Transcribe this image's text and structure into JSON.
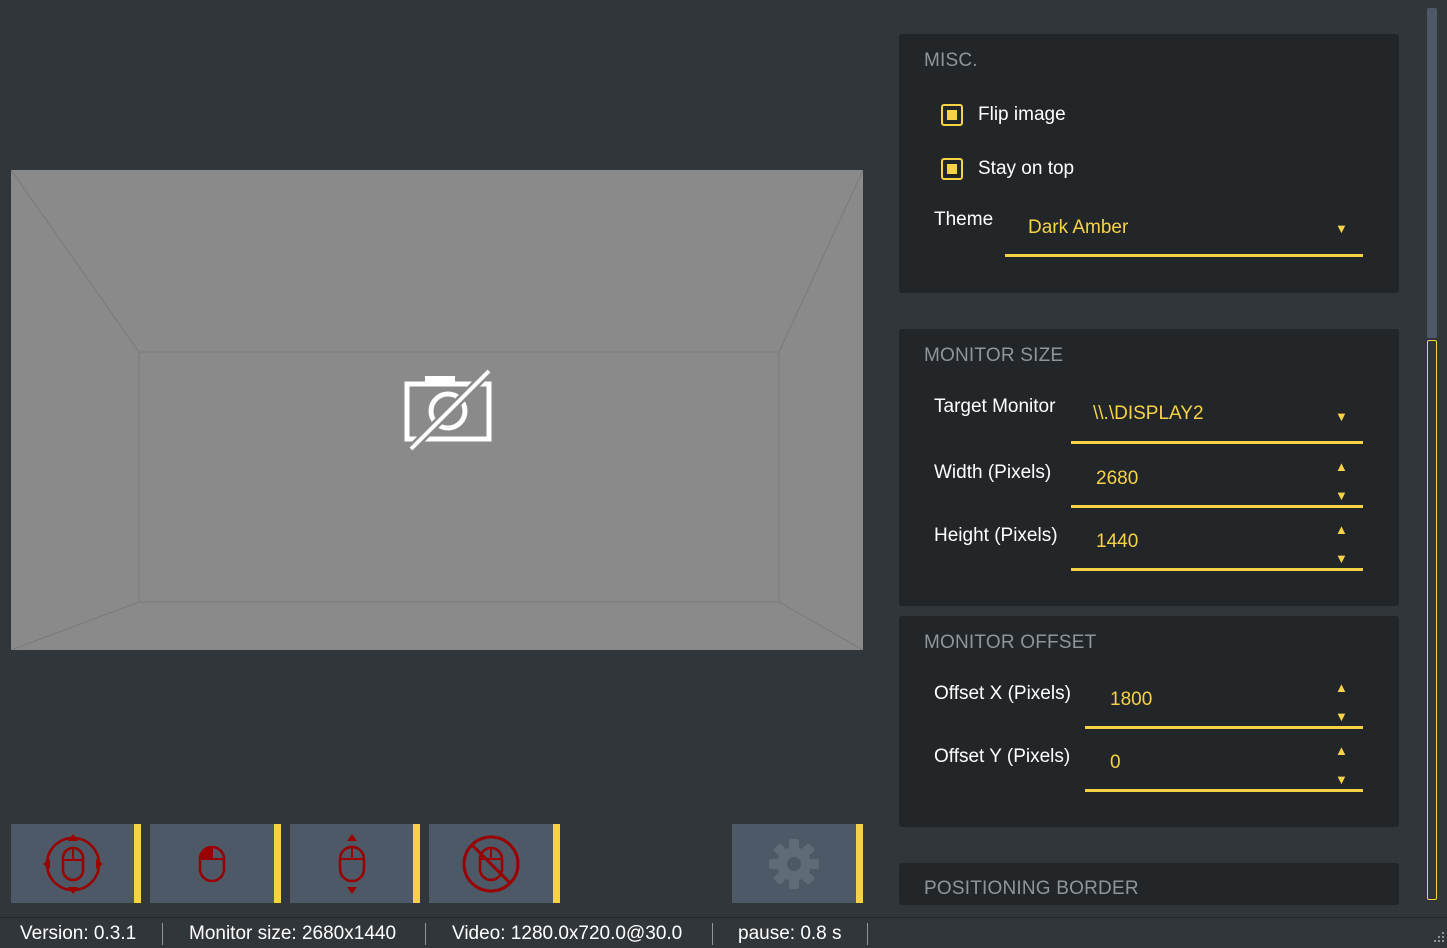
{
  "preview": {
    "icon": "no-camera-icon"
  },
  "toolbar": {
    "buttons": [
      {
        "icon": "mouse-move-all-icon"
      },
      {
        "icon": "mouse-click-icon"
      },
      {
        "icon": "mouse-vertical-icon"
      },
      {
        "icon": "mouse-disabled-icon"
      },
      {
        "icon": "gear-icon"
      }
    ],
    "accent": "#f7d247",
    "icon_color": "#990000"
  },
  "misc": {
    "title": "MISC.",
    "flip_image_label": "Flip image",
    "flip_image_checked": true,
    "stay_on_top_label": "Stay on top",
    "stay_on_top_checked": true,
    "theme_label": "Theme",
    "theme_value": "Dark Amber"
  },
  "monitor_size": {
    "title": "MONITOR SIZE",
    "target_label": "Target Monitor",
    "target_value": "\\\\.\\DISPLAY2",
    "width_label": "Width (Pixels)",
    "width_value": "2680",
    "height_label": "Height (Pixels)",
    "height_value": "1440"
  },
  "monitor_offset": {
    "title": "MONITOR OFFSET",
    "offset_x_label": "Offset X (Pixels)",
    "offset_x_value": "1800",
    "offset_y_label": "Offset Y (Pixels)",
    "offset_y_value": "0"
  },
  "positioning_border": {
    "title": "POSITIONING BORDER"
  },
  "status": {
    "version": "Version: 0.3.1",
    "monitor_size": "Monitor size: 2680x1440",
    "video": "Video: 1280.0x720.0@30.0",
    "pause": "pause: 0.8 s"
  },
  "colors": {
    "accent": "#f7d247",
    "panel": "#232629",
    "background": "#31363b"
  }
}
